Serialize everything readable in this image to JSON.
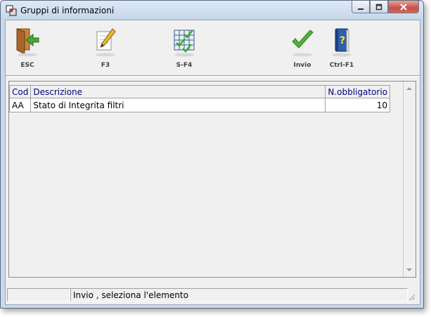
{
  "window": {
    "title": "Gruppi di informazioni"
  },
  "toolbar": {
    "buttons": [
      {
        "key": "ESC",
        "icon": "exit-door-icon"
      },
      {
        "key": "F3",
        "icon": "pencil-edit-icon"
      },
      {
        "key": "S-F4",
        "icon": "grid-check-icon"
      },
      {
        "key": "Invio",
        "icon": "checkmark-icon"
      },
      {
        "key": "Ctrl-F1",
        "icon": "help-book-icon"
      }
    ]
  },
  "table": {
    "columns": [
      "Cod",
      "Descrizione",
      "N.obbligatorio"
    ],
    "rows": [
      {
        "cod": "AA",
        "descrizione": "Stato di Integrita filtri",
        "obbligatorio": "10"
      }
    ]
  },
  "status": {
    "left": "",
    "message": "Invio , seleziona l'elemento"
  },
  "colors": {
    "header_text": "#000080",
    "client_bg": "#f0f0f0",
    "title_bar": "#c5d6ea"
  }
}
